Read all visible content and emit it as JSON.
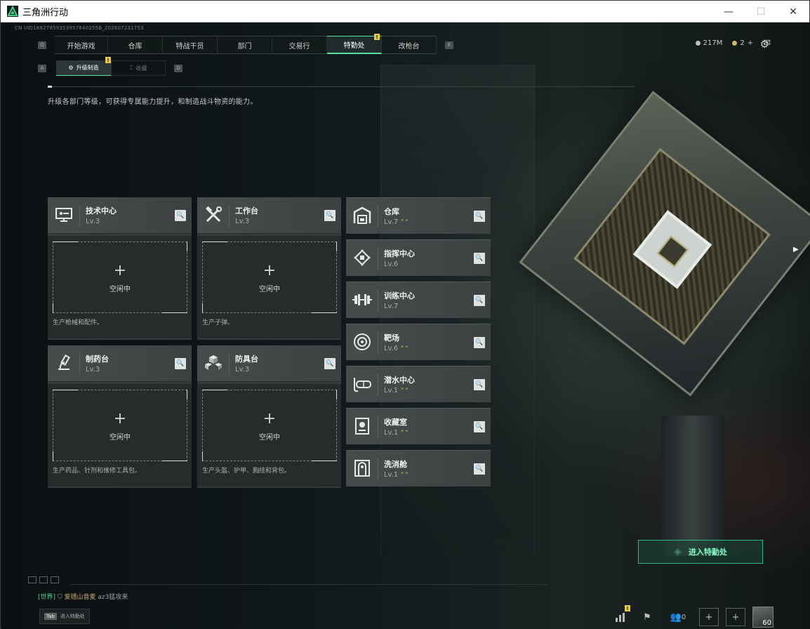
{
  "window": {
    "title": "三角洲行动",
    "minimize": "—",
    "maximize": "☐",
    "close": "✕"
  },
  "uid": "CN UID18927859353957640255B_202607231753",
  "top_nav": {
    "key_left": "Q",
    "key_right": "E",
    "tabs": [
      {
        "label": "开始游戏"
      },
      {
        "label": "仓库"
      },
      {
        "label": "特战干员"
      },
      {
        "label": "部门"
      },
      {
        "label": "交易行"
      },
      {
        "label": "特勤处",
        "active": true,
        "badge": "!"
      },
      {
        "label": "改枪台"
      }
    ]
  },
  "currency": {
    "coins": "217M",
    "tickets": "2",
    "tickets_add": "+"
  },
  "sub_tabs": {
    "key_left": "A",
    "key_right": "D",
    "active": {
      "label": "升级制造",
      "badge": "!"
    },
    "inactive": {
      "label": "收藏"
    }
  },
  "description": "升级各部门等级，可获得专属能力提升，和制造战斗物资的能力。",
  "production_cards": [
    {
      "name": "技术中心",
      "level": "Lv.3",
      "icon": "monitor-icon",
      "status": "空闲中",
      "plus": "+",
      "desc": "生产枪械和配件。"
    },
    {
      "name": "工作台",
      "level": "Lv.3",
      "icon": "tools-icon",
      "status": "空闲中",
      "plus": "+",
      "desc": "生产子弹。"
    },
    {
      "name": "制药台",
      "level": "Lv.3",
      "icon": "microscope-icon",
      "status": "空闲中",
      "plus": "+",
      "desc": "生产药品、针剂和维修工具包。"
    },
    {
      "name": "防具台",
      "level": "Lv.3",
      "icon": "boxes-icon",
      "status": "空闲中",
      "plus": "+",
      "desc": "生产头盔、护甲、胸挂和背包。"
    }
  ],
  "department_cards": [
    {
      "name": "仓库",
      "level": "Lv.7",
      "upgradable": true,
      "icon": "warehouse-icon"
    },
    {
      "name": "指挥中心",
      "level": "Lv.6",
      "upgradable": false,
      "icon": "chip-icon"
    },
    {
      "name": "训练中心",
      "level": "Lv.7",
      "upgradable": false,
      "icon": "dumbbell-icon"
    },
    {
      "name": "靶场",
      "level": "Lv.6",
      "upgradable": true,
      "icon": "target-icon"
    },
    {
      "name": "潜水中心",
      "level": "Lv.1",
      "upgradable": true,
      "icon": "diving-mask-icon"
    },
    {
      "name": "收藏室",
      "level": "Lv.1",
      "upgradable": true,
      "icon": "trophy-case-icon"
    },
    {
      "name": "洗消舱",
      "level": "Lv.1",
      "upgradable": true,
      "icon": "decon-pod-icon"
    }
  ],
  "upgrade_arrows": "⌃⌃",
  "enter_button": "进入特勤处",
  "chat": {
    "channel": "[世界]",
    "user": "爱错山音麦",
    "message": "az3猛攻来"
  },
  "tab_hint": {
    "key": "Tab",
    "label": "进入特勤处"
  },
  "bottom_bar": {
    "friends_count": "0",
    "stats_badge": "!",
    "plus1": "+",
    "plus2": "+",
    "avatar_level": "60"
  },
  "colors": {
    "accent": "#55e0a8",
    "badge": "#e7c84b",
    "upgrade": "#e0b840"
  }
}
